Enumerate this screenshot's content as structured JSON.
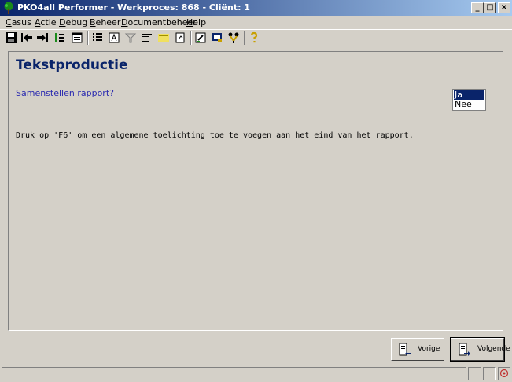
{
  "window": {
    "title": "PKO4all Performer - Werkproces: 868 - Cliënt: 1",
    "controls": {
      "minimize": "_",
      "maximize": "□",
      "close": "×"
    }
  },
  "menu": {
    "items": [
      {
        "first": "C",
        "rest": "asus"
      },
      {
        "first": "A",
        "rest": "ctie"
      },
      {
        "first": "D",
        "rest": "ebug"
      },
      {
        "first": "B",
        "rest": "eheer"
      },
      {
        "first": "D",
        "rest": "ocumentbeheer"
      },
      {
        "first": "H",
        "rest": "elp"
      }
    ]
  },
  "toolbar": {
    "icons": [
      "save-icon",
      "back-arrow-icon",
      "forward-arrow-icon",
      "tree-list-icon",
      "calendar-icon",
      "list-icon",
      "text-box-icon",
      "filter-icon",
      "align-left-icon",
      "highlight-icon",
      "document-icon",
      "edit-form-icon",
      "screen-icon",
      "transfer-icon",
      "help-icon"
    ],
    "colors": {
      "help": "#c8a000",
      "accent": "#0a246a"
    }
  },
  "content": {
    "title": "Tekstproductie",
    "question": "Samenstellen rapport?",
    "options": [
      "Ja",
      "Nee"
    ],
    "selected_option": "Ja",
    "info": "Druk op 'F6' om een algemene toelichting toe te voegen aan het eind van het rapport."
  },
  "buttons": {
    "previous": "Vorige",
    "next": "Volgende"
  }
}
